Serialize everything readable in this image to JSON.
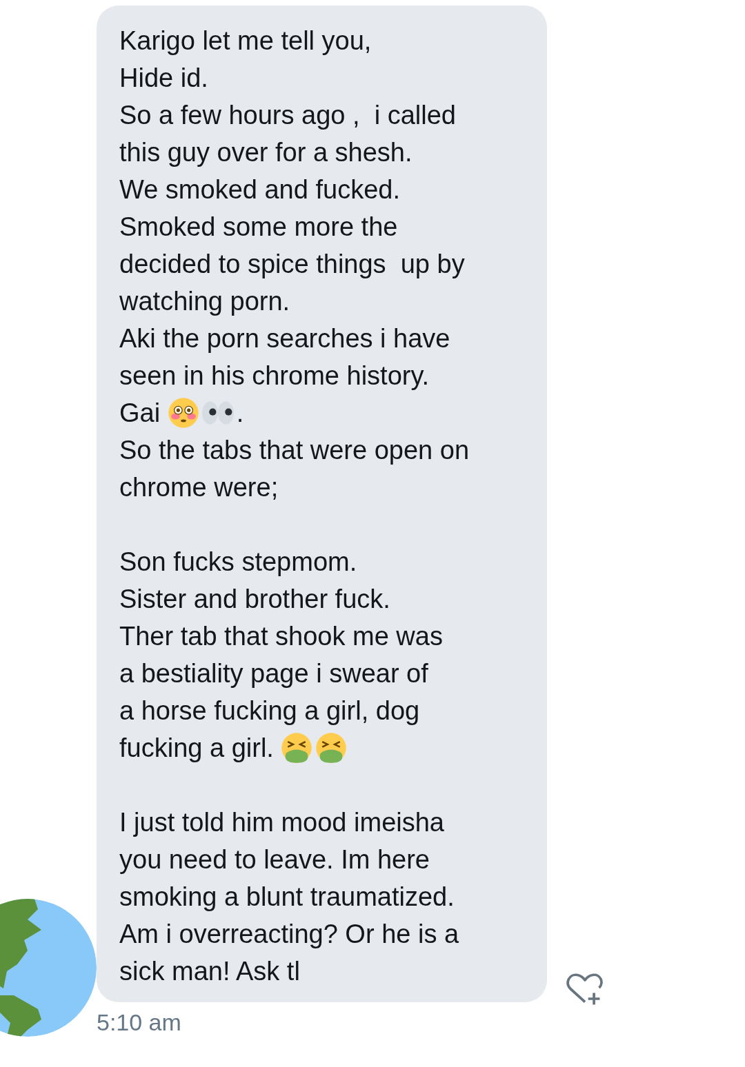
{
  "message": {
    "paragraphs": [
      {
        "lines": [
          [
            {
              "kind": "text",
              "text": "Karigo let me tell you,"
            }
          ],
          [
            {
              "kind": "text",
              "text": "Hide id."
            }
          ],
          [
            {
              "kind": "text",
              "text": "So a few hours ago ,  i called"
            }
          ],
          [
            {
              "kind": "text",
              "text": "this guy over for a shesh."
            }
          ],
          [
            {
              "kind": "text",
              "text": "We smoked and fucked."
            }
          ],
          [
            {
              "kind": "text",
              "text": "Smoked some more the"
            }
          ],
          [
            {
              "kind": "text",
              "text": "decided to spice things  up by"
            }
          ],
          [
            {
              "kind": "text",
              "text": "watching porn."
            }
          ],
          [
            {
              "kind": "text",
              "text": "Aki the porn searches i have"
            }
          ],
          [
            {
              "kind": "text",
              "text": "seen in his chrome history."
            }
          ],
          [
            {
              "kind": "text",
              "text": "Gai "
            },
            {
              "kind": "flushed"
            },
            {
              "kind": "eyes"
            },
            {
              "kind": "text",
              "text": "."
            }
          ],
          [
            {
              "kind": "text",
              "text": "So the tabs that were open on"
            }
          ],
          [
            {
              "kind": "text",
              "text": "chrome were;"
            }
          ]
        ]
      },
      {
        "lines": [
          [
            {
              "kind": "text",
              "text": "Son fucks stepmom."
            }
          ],
          [
            {
              "kind": "text",
              "text": "Sister and brother fuck."
            }
          ],
          [
            {
              "kind": "text",
              "text": "Ther tab that shook me was"
            }
          ],
          [
            {
              "kind": "text",
              "text": "a bestiality page i swear of"
            }
          ],
          [
            {
              "kind": "text",
              "text": "a horse fucking a girl, dog"
            }
          ],
          [
            {
              "kind": "text",
              "text": "fucking a girl. "
            },
            {
              "kind": "vomit"
            },
            {
              "kind": "vomit"
            }
          ]
        ]
      },
      {
        "lines": [
          [
            {
              "kind": "text",
              "text": "I just told him mood imeisha"
            }
          ],
          [
            {
              "kind": "text",
              "text": "you need to leave. Im here"
            }
          ],
          [
            {
              "kind": "text",
              "text": "smoking a blunt traumatized."
            }
          ],
          [
            {
              "kind": "text",
              "text": "Am i overreacting? Or he is a"
            }
          ],
          [
            {
              "kind": "text",
              "text": "sick man! Ask tl"
            }
          ]
        ]
      }
    ],
    "time": "5:10 am"
  }
}
